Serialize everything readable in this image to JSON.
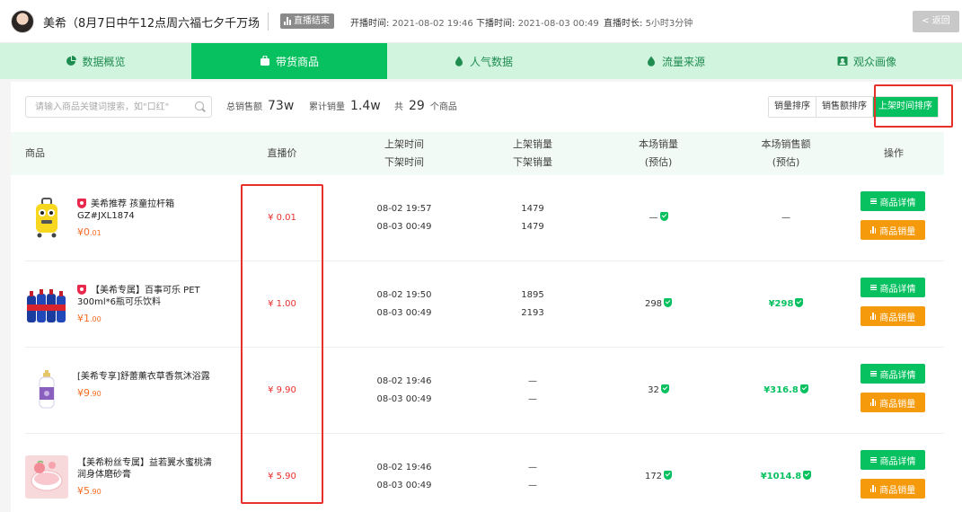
{
  "header": {
    "title": "美希（8月7日中午12点周六福七夕千万场",
    "status": "直播结束",
    "start_label": "开播时间:",
    "start_value": "2021-08-02 19:46",
    "end_label": "下播时间:",
    "end_value": "2021-08-03 00:49",
    "duration_label": "直播时长:",
    "duration_value": "5小时3分钟",
    "back_label": "< 返回"
  },
  "tabs": [
    {
      "label": "数据概览",
      "icon": "pie-chart-icon"
    },
    {
      "label": "带货商品",
      "icon": "bag-icon",
      "active": true
    },
    {
      "label": "人气数据",
      "icon": "drop-icon"
    },
    {
      "label": "流量来源",
      "icon": "drop-icon"
    },
    {
      "label": "观众画像",
      "icon": "portrait-icon"
    }
  ],
  "toolbar": {
    "search_placeholder": "请输入商品关键词搜索，如\"口红\"",
    "total_sales_label": "总销售额",
    "total_sales_value": "73w",
    "total_volume_label": "累计销量",
    "total_volume_value": "1.4w",
    "count_prefix": "共",
    "count_value": "29",
    "count_suffix": "个商品",
    "sort_buttons": [
      "销量排序",
      "销售额排序",
      "上架时间排序"
    ]
  },
  "table": {
    "headers": {
      "product": "商品",
      "live_price": "直播价",
      "time_on": "上架时间",
      "time_off": "下架时间",
      "sales_on": "上架销量",
      "sales_off": "下架销量",
      "session_sales": "本场销量",
      "session_sales_sub": "(预估)",
      "session_amount": "本场销售额",
      "session_amount_sub": "(预估)",
      "ops": "操作"
    },
    "op_detail_label": "商品详情",
    "op_sales_label": "商品销量",
    "rows": [
      {
        "name": "美希推荐 孩童拉杆箱 GZ#JXL1874",
        "verified": true,
        "price_int": "¥0",
        "price_dec": ".01",
        "live_price": "¥ 0.01",
        "time_on": "08-02 19:57",
        "time_off": "08-03 00:49",
        "sales_on": "1479",
        "sales_off": "1479",
        "session_sales": "—",
        "session_amount": "—",
        "amount_green": false
      },
      {
        "name": "【美希专属】百事可乐 PET 300ml*6瓶可乐饮料",
        "verified": true,
        "price_int": "¥1",
        "price_dec": ".00",
        "live_price": "¥ 1.00",
        "time_on": "08-02 19:50",
        "time_off": "08-03 00:49",
        "sales_on": "1895",
        "sales_off": "2193",
        "session_sales": "298",
        "session_amount": "¥298",
        "amount_green": true
      },
      {
        "name": "[美希专享]舒蕾薰衣草香氛沐浴露",
        "verified": false,
        "price_int": "¥9",
        "price_dec": ".90",
        "live_price": "¥ 9.90",
        "time_on": "08-02 19:46",
        "time_off": "08-03 00:49",
        "sales_on": "—",
        "sales_off": "—",
        "session_sales": "32",
        "session_amount": "¥316.8",
        "amount_green": true
      },
      {
        "name": "【美希粉丝专属】益若翼水蜜桃清润身体磨砂膏",
        "verified": false,
        "price_int": "¥5",
        "price_dec": ".90",
        "live_price": "¥ 5.90",
        "time_on": "08-02 19:46",
        "time_off": "08-03 00:49",
        "sales_on": "—",
        "sales_off": "—",
        "session_sales": "172",
        "session_amount": "¥1014.8",
        "amount_green": true
      }
    ]
  }
}
